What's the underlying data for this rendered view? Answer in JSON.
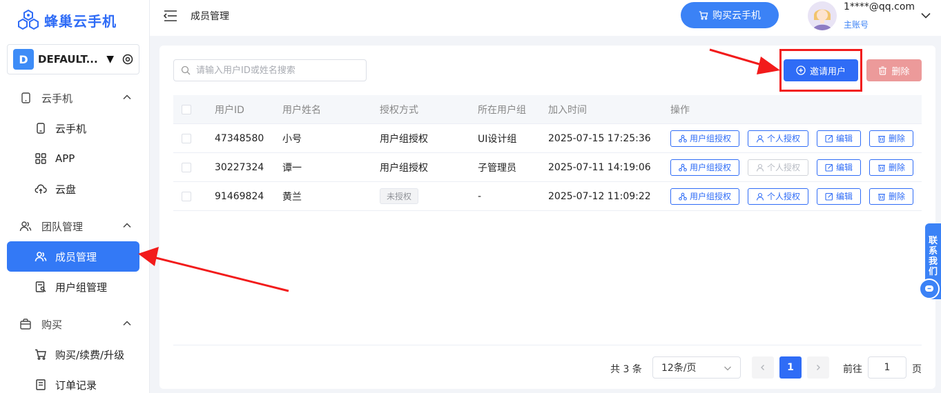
{
  "app": {
    "name": "蜂巢云手机"
  },
  "team": {
    "badge": "D",
    "name": "DEFAULT..."
  },
  "sidebar": {
    "groups": [
      {
        "label": "云手机",
        "items": [
          {
            "label": "云手机"
          },
          {
            "label": "APP"
          },
          {
            "label": "云盘"
          }
        ]
      },
      {
        "label": "团队管理",
        "items": [
          {
            "label": "成员管理"
          },
          {
            "label": "用户组管理"
          }
        ]
      },
      {
        "label": "购买",
        "items": [
          {
            "label": "购买/续费/升级"
          },
          {
            "label": "订单记录"
          }
        ]
      }
    ]
  },
  "header": {
    "title": "成员管理",
    "buy_label": "购买云手机",
    "user_email": "1****@qq.com",
    "user_role": "主账号"
  },
  "toolbar": {
    "search_placeholder": "请输入用户ID或姓名搜索",
    "invite_label": "邀请用户",
    "delete_label": "删除"
  },
  "table": {
    "headers": [
      "用户ID",
      "用户姓名",
      "授权方式",
      "所在用户组",
      "加入时间",
      "操作"
    ],
    "rows": [
      {
        "id": "47348580",
        "name": "小号",
        "auth": "用户组授权",
        "group": "UI设计组",
        "time": "2025-07-15 17:25:36",
        "unauthorized": false,
        "personal_disabled": false
      },
      {
        "id": "30227324",
        "name": "谭一",
        "auth": "用户组授权",
        "group": "子管理员",
        "time": "2025-07-11 14:19:06",
        "unauthorized": false,
        "personal_disabled": true
      },
      {
        "id": "91469824",
        "name": "黄兰",
        "auth": "未授权",
        "group": "-",
        "time": "2025-07-12 11:09:22",
        "unauthorized": true,
        "personal_disabled": false
      }
    ],
    "ops": {
      "group_auth": "用户组授权",
      "personal_auth": "个人授权",
      "edit": "编辑",
      "delete": "删除"
    }
  },
  "pagination": {
    "total_text": "共 3 条",
    "page_size": "12条/页",
    "current_page": "1",
    "goto_label": "前往",
    "goto_value": "1",
    "goto_suffix": "页"
  },
  "contact": {
    "label": "联系我们"
  },
  "colors": {
    "primary": "#2f6cf6",
    "danger_light": "#ec9a9a",
    "annotation_red": "#f21b1b"
  }
}
